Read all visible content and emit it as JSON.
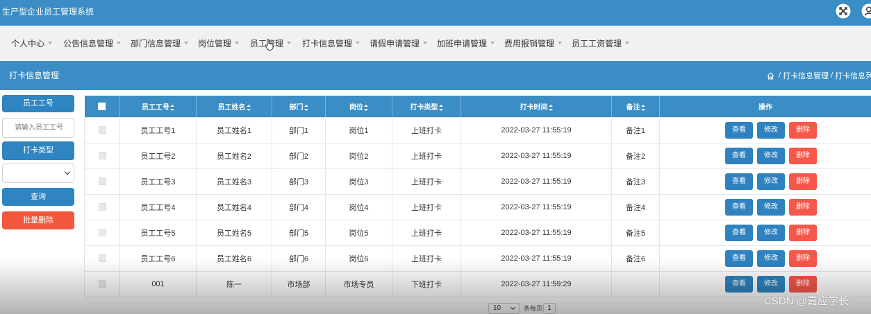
{
  "app": {
    "title": "生产型企业员工管理系统"
  },
  "icons": {
    "close": "close-circle-icon",
    "user": "user-icon",
    "home": "home-icon",
    "dropdown": "caret-down-icon",
    "sort": "sort-icon",
    "cursor": "mouse-cursor-icon"
  },
  "nav": {
    "items": [
      "个人中心",
      "公告信息管理",
      "部门信息管理",
      "岗位管理",
      "员工管理",
      "打卡信息管理",
      "请假申请管理",
      "加班申请管理",
      "费用报销管理",
      "员工工资管理"
    ]
  },
  "page_bar": {
    "title": "打卡信息管理",
    "separator": "/",
    "breadcrumb": [
      "打卡信息管理",
      "打卡信息列表"
    ]
  },
  "search": {
    "employee_id_label": "员工工号",
    "employee_id_placeholder": "请输入员工工号",
    "employee_id_value": "",
    "punch_type_label": "打卡类型",
    "punch_type_value": "",
    "query_button": "查询",
    "batch_delete_button": "批量删除"
  },
  "table": {
    "columns": [
      "员工工号",
      "员工姓名",
      "部门",
      "岗位",
      "打卡类型",
      "打卡时间",
      "备注",
      "操作"
    ],
    "rows": [
      {
        "employee_id": "员工工号1",
        "employee_name": "员工姓名1",
        "department": "部门1",
        "job_post": "岗位1",
        "punch_type": "上班打卡",
        "punch_time": "2022-03-27 11:55:19",
        "remark": "备注1"
      },
      {
        "employee_id": "员工工号2",
        "employee_name": "员工姓名2",
        "department": "部门2",
        "job_post": "岗位2",
        "punch_type": "上班打卡",
        "punch_time": "2022-03-27 11:55:19",
        "remark": "备注2"
      },
      {
        "employee_id": "员工工号3",
        "employee_name": "员工姓名3",
        "department": "部门3",
        "job_post": "岗位3",
        "punch_type": "上班打卡",
        "punch_time": "2022-03-27 11:55:19",
        "remark": "备注3"
      },
      {
        "employee_id": "员工工号4",
        "employee_name": "员工姓名4",
        "department": "部门4",
        "job_post": "岗位4",
        "punch_type": "上班打卡",
        "punch_time": "2022-03-27 11:55:19",
        "remark": "备注4"
      },
      {
        "employee_id": "员工工号5",
        "employee_name": "员工姓名5",
        "department": "部门5",
        "job_post": "岗位5",
        "punch_type": "上班打卡",
        "punch_time": "2022-03-27 11:55:19",
        "remark": "备注5"
      },
      {
        "employee_id": "员工工号6",
        "employee_name": "员工姓名6",
        "department": "部门6",
        "job_post": "岗位6",
        "punch_type": "上班打卡",
        "punch_time": "2022-03-27 11:55:19",
        "remark": "备注6"
      },
      {
        "employee_id": "001",
        "employee_name": "陈一",
        "department": "市场部",
        "job_post": "市场专员",
        "punch_type": "下班打卡",
        "punch_time": "2022-03-27 11:59:29",
        "remark": ""
      }
    ],
    "actions": {
      "view": "查看",
      "edit": "修改",
      "delete": "删除"
    }
  },
  "pagination": {
    "page_size": "10",
    "page_size_suffix": "条每页",
    "current_page": "1"
  },
  "watermark": "CSDN @嘉应学长",
  "colors": {
    "primary": "#3a8dc5",
    "button_blue": "#2f82bf",
    "danger": "#f5574b",
    "batch_delete": "#f3583d",
    "nav_background": "#f1f1f1",
    "text": "#333333"
  }
}
